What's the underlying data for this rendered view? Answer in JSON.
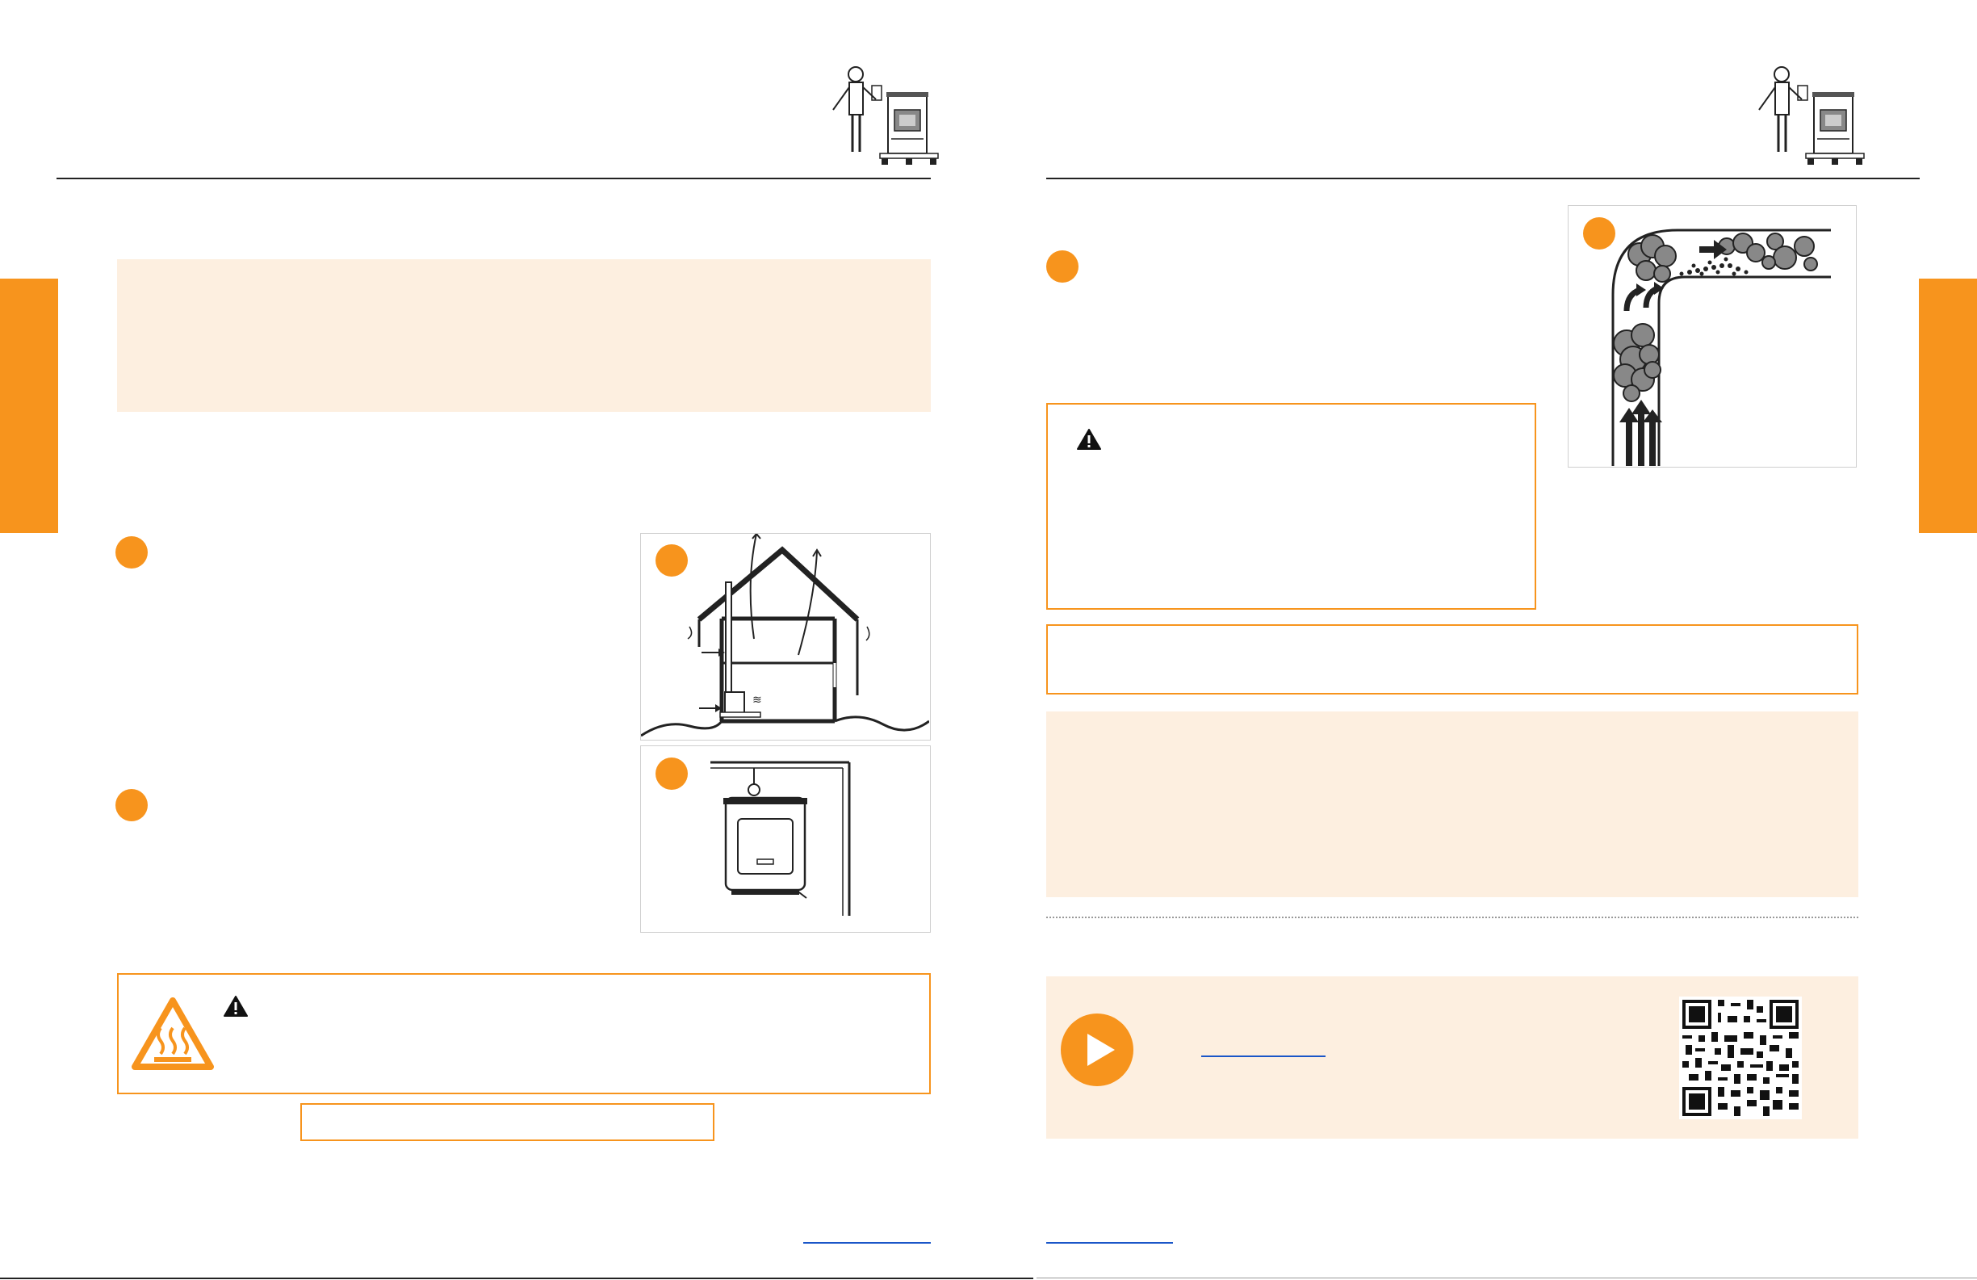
{
  "colors": {
    "accent": "#f7941d",
    "callout_fill": "#fdefe0",
    "link": "#1a56c8",
    "rule": "#222222"
  },
  "left_page": {
    "callout_top_text": "",
    "step1_text": "",
    "step2_text": "",
    "figure1_caption": "",
    "figure2_caption": "",
    "hot_warning_text": "",
    "note_box_text": "",
    "footer_link": ""
  },
  "right_page": {
    "step_text": "",
    "warning_box_text": "",
    "notice_box_text": "",
    "info_callout_text": "",
    "video_link": "",
    "footer_link": ""
  },
  "icons": {
    "header": "technician-with-stove-icon",
    "warning": "warning-triangle-icon",
    "hot_surface": "hot-surface-icon",
    "play": "play-icon",
    "qr": "qr-code"
  }
}
